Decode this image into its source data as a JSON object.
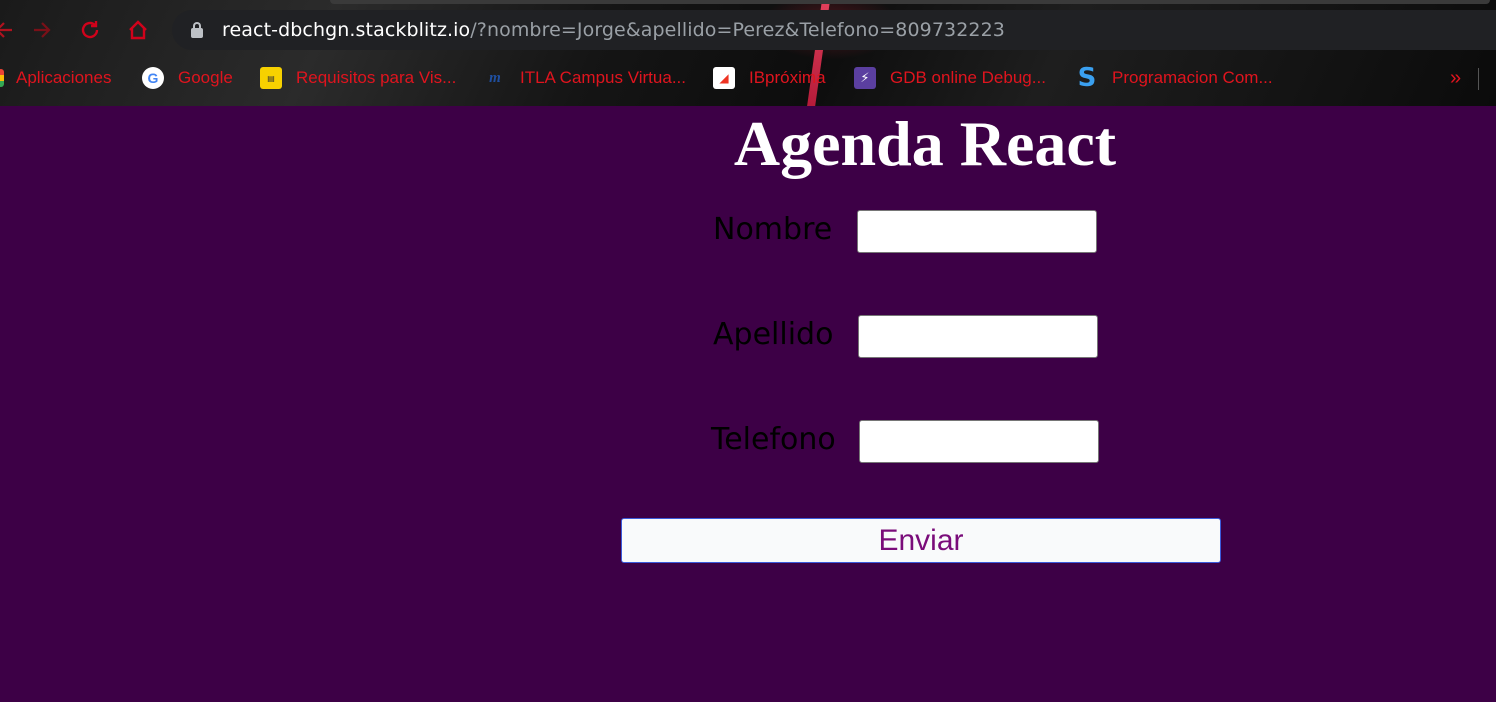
{
  "browser": {
    "url_host": "react-dbchgn.stackblitz.io",
    "url_path": "/?nombre=Jorge&apellido=Perez&Telefono=809732223",
    "nav_icons": [
      "back-arrow-icon",
      "forward-arrow-icon",
      "reload-icon",
      "home-icon"
    ],
    "bookmarks": [
      {
        "label": "Aplicaciones",
        "icon": "apps-grid-icon"
      },
      {
        "label": "Google",
        "icon": "google-icon"
      },
      {
        "label": "Requisitos para Vis...",
        "icon": "document-icon"
      },
      {
        "label": "ITLA Campus Virtua...",
        "icon": "itla-icon"
      },
      {
        "label": "IBpróxima",
        "icon": "iberia-icon"
      },
      {
        "label": "GDB online Debug...",
        "icon": "gdb-icon"
      },
      {
        "label": "Programacion Com...",
        "icon": "s-logo-icon"
      }
    ],
    "more_label": "»",
    "accent_color": "#e0141e"
  },
  "page": {
    "title": "Agenda React",
    "background_color": "#3d0046",
    "fields": [
      {
        "label": "Nombre",
        "value": "",
        "placeholder": ""
      },
      {
        "label": "Apellido",
        "value": "",
        "placeholder": ""
      },
      {
        "label": "Telefono",
        "value": "",
        "placeholder": ""
      }
    ],
    "submit_label": "Enviar"
  }
}
